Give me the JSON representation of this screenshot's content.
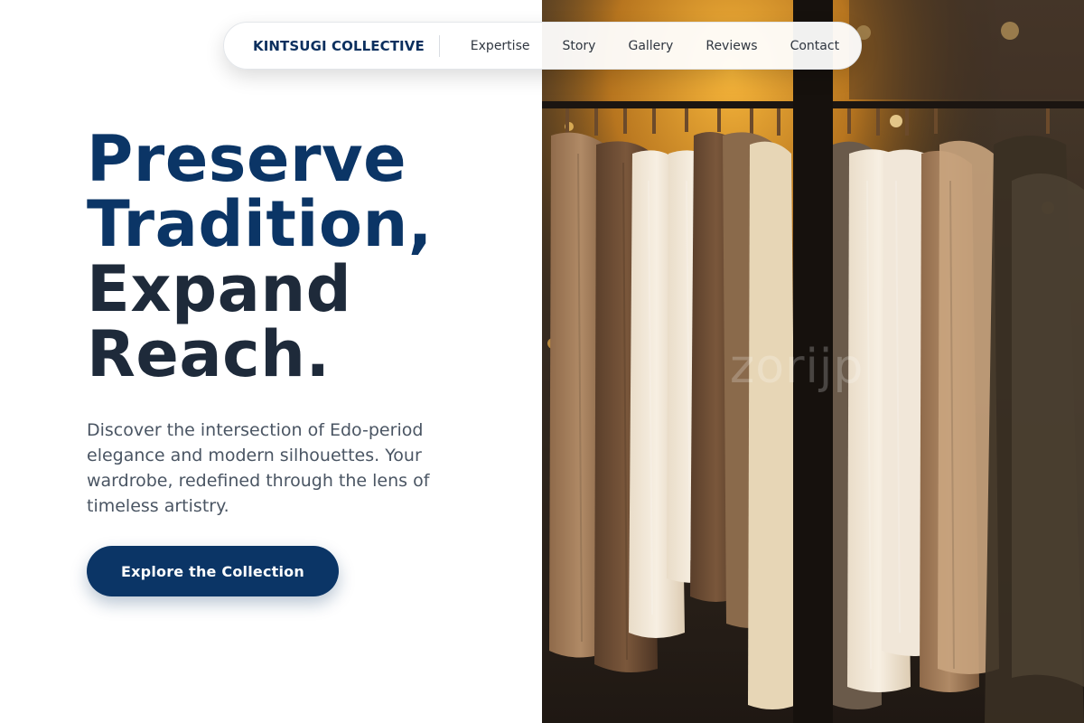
{
  "nav": {
    "brand": "KINTSUGI COLLECTIVE",
    "links": [
      {
        "label": "Expertise"
      },
      {
        "label": "Story"
      },
      {
        "label": "Gallery"
      },
      {
        "label": "Reviews"
      },
      {
        "label": "Contact"
      }
    ]
  },
  "hero": {
    "headline_blue_1": "Preserve",
    "headline_blue_2": "Tradition,",
    "headline_dark_1": "Expand",
    "headline_dark_2": "Reach.",
    "subtext": "Discover the intersection of Edo-period elegance and modern silhouettes. Your wardrobe, redefined through the lens of timeless artistry.",
    "cta_label": "Explore the Collection"
  },
  "photo": {
    "watermark": "zorijp",
    "subject": "knitwear-on-clothing-rack"
  },
  "colors": {
    "brand_navy": "#0b3566",
    "heading_dark": "#1e2a3a",
    "body_text": "#4a5563",
    "background": "#ffffff"
  }
}
